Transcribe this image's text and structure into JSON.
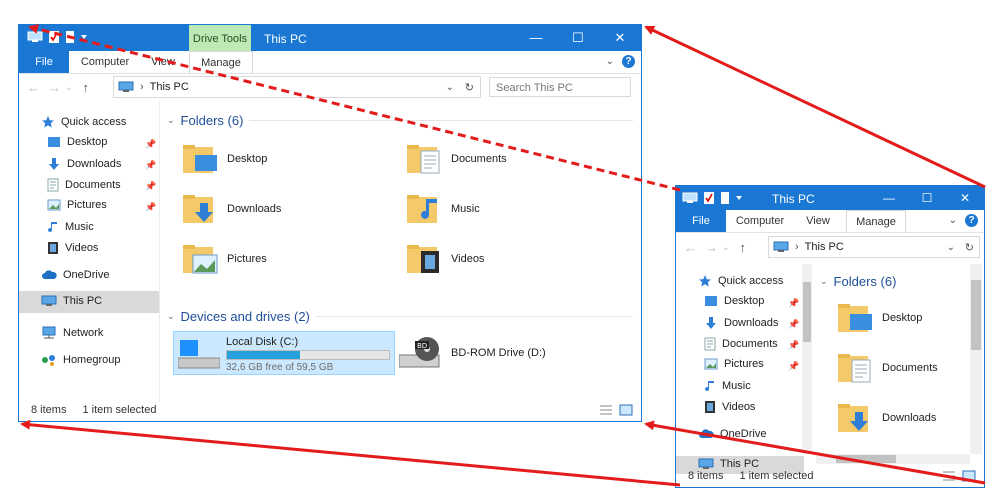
{
  "big_window": {
    "title": "This PC",
    "context_tab": "Drive Tools",
    "controls": {
      "minimize": "—",
      "maximize": "☐",
      "close": "✕"
    },
    "ribbon_tabs": {
      "file": "File",
      "computer": "Computer",
      "view": "View",
      "manage": "Manage"
    },
    "ribbon_right": {
      "collapse": "⌄",
      "help": "?"
    },
    "address": {
      "back": "←",
      "forward": "→",
      "up": "↑",
      "separator": "›",
      "path": "This PC",
      "dropdown": "⌄",
      "refresh": "↻"
    },
    "search": {
      "placeholder": "Search This PC"
    },
    "nav": {
      "quick_access": "Quick access",
      "desktop": "Desktop",
      "downloads": "Downloads",
      "documents": "Documents",
      "pictures": "Pictures",
      "music": "Music",
      "videos": "Videos",
      "onedrive": "OneDrive",
      "thispc": "This PC",
      "network": "Network",
      "homegroup": "Homegroup",
      "pin": "📌"
    },
    "folders_header": "Folders (6)",
    "folders": {
      "desktop": "Desktop",
      "documents": "Documents",
      "downloads": "Downloads",
      "music": "Music",
      "pictures": "Pictures",
      "videos": "Videos"
    },
    "devices_header": "Devices and drives (2)",
    "drives": {
      "c_name": "Local Disk (C:)",
      "c_free": "32,6 GB free of 59,5 GB",
      "c_used_fraction": 0.45,
      "d_name": "BD-ROM Drive (D:)",
      "d_badge": "BD"
    },
    "status": {
      "items": "8 items",
      "selected": "1 item selected"
    }
  },
  "small_window": {
    "title": "This PC",
    "controls": {
      "minimize": "—",
      "maximize": "☐",
      "close": "✕"
    },
    "ribbon_tabs": {
      "file": "File",
      "computer": "Computer",
      "view": "View",
      "manage": "Manage"
    },
    "ribbon_right": {
      "collapse": "⌄",
      "help": "?"
    },
    "address": {
      "back": "←",
      "forward": "→",
      "up": "↑",
      "separator": "›",
      "path": "This PC",
      "dropdown": "⌄",
      "refresh": "↻"
    },
    "nav": {
      "quick_access": "Quick access",
      "desktop": "Desktop",
      "downloads": "Downloads",
      "documents": "Documents",
      "pictures": "Pictures",
      "music": "Music",
      "videos": "Videos",
      "onedrive": "OneDrive",
      "thispc": "This PC",
      "pin": "📌"
    },
    "folders_header": "Folders (6)",
    "folders": {
      "desktop": "Desktop",
      "documents": "Documents",
      "downloads": "Downloads"
    },
    "status": {
      "items": "8 items",
      "selected": "1 item selected"
    }
  },
  "colors": {
    "accent": "#1a78d4",
    "arrow": "#e31b1b",
    "drive_tools": "#bde9b4",
    "selection": "#cce8ff"
  }
}
